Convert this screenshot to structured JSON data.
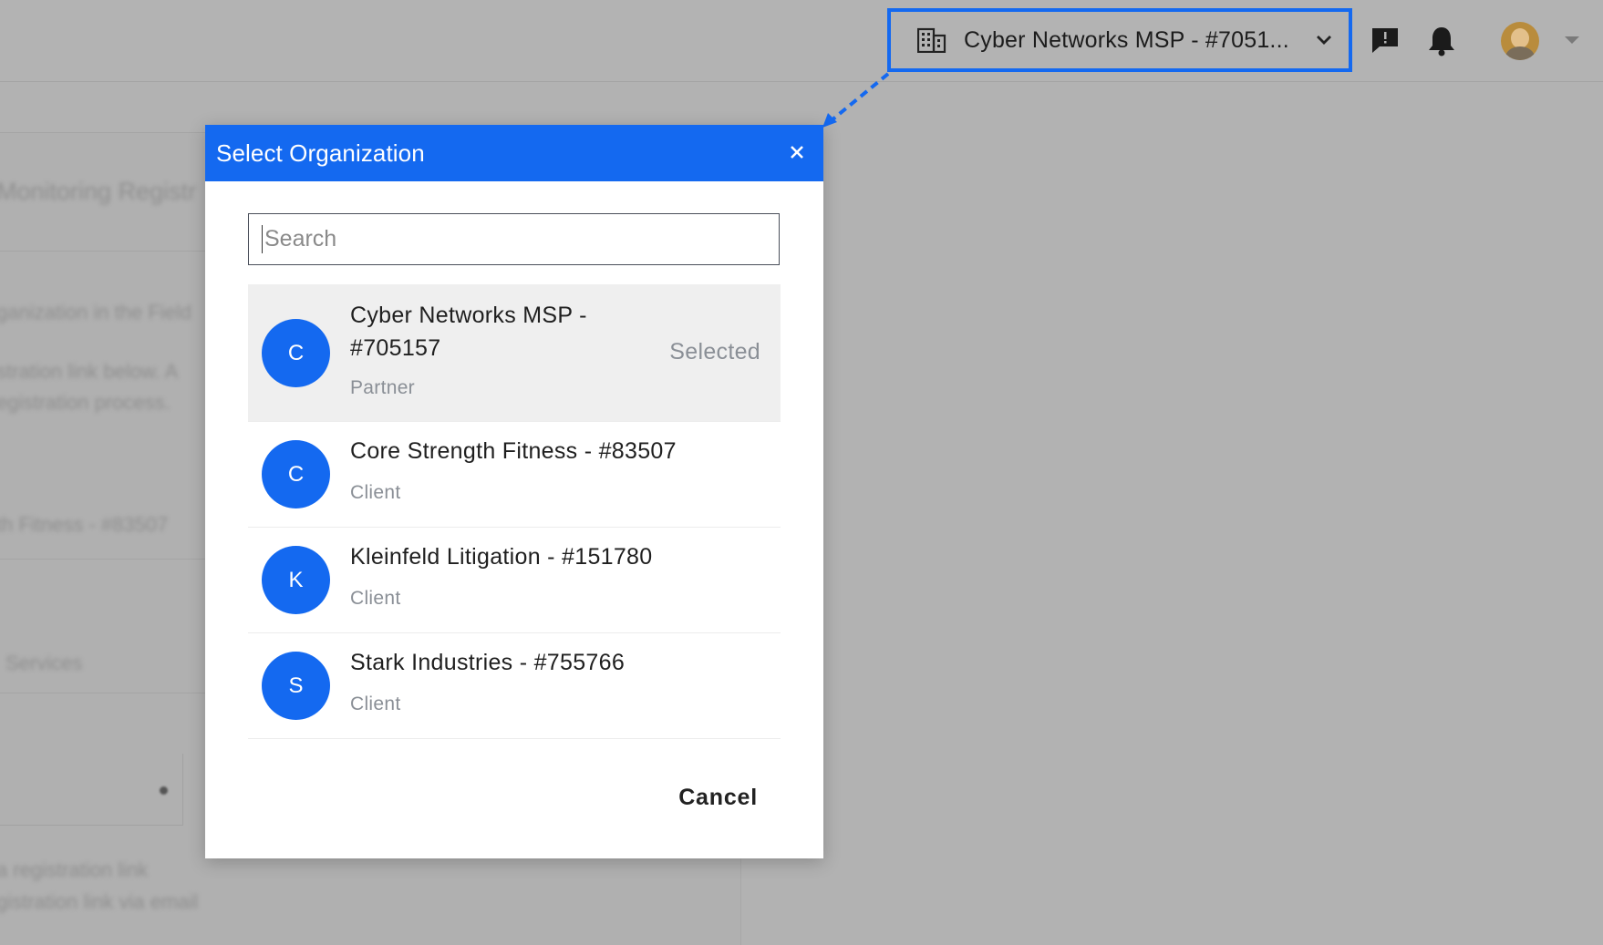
{
  "topbar": {
    "org_switcher_label": "Cyber Networks MSP - #7051...",
    "accent_color": "#1469f0"
  },
  "background": {
    "texts": [
      "Monitoring Registr",
      "ganization in the Field",
      "stration link below. A",
      "egistration process.",
      "th Fitness - #83507",
      "Services",
      "a registration link",
      "gistration link via email"
    ]
  },
  "modal": {
    "title": "Select Organization",
    "search_placeholder": "Search",
    "organizations": [
      {
        "initial": "C",
        "name": "Cyber Networks MSP - #705157",
        "type": "Partner",
        "selected": true,
        "selected_label": "Selected"
      },
      {
        "initial": "C",
        "name": "Core Strength Fitness - #83507",
        "type": "Client",
        "selected": false
      },
      {
        "initial": "K",
        "name": "Kleinfeld Litigation - #151780",
        "type": "Client",
        "selected": false
      },
      {
        "initial": "S",
        "name": "Stark Industries - #755766",
        "type": "Client",
        "selected": false
      }
    ],
    "cancel_label": "Cancel"
  },
  "icons": {
    "org_switcher": "building-icon",
    "dropdown": "chevron-down-icon",
    "chat": "chat-alert-icon",
    "notifications": "bell-icon",
    "user": "avatar",
    "close": "close-icon"
  }
}
